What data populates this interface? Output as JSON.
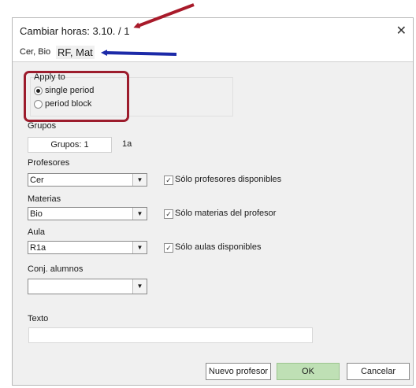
{
  "window": {
    "title": "Cambiar horas:  3.10. / 1",
    "close_glyph": "✕"
  },
  "tabs": [
    {
      "label": "Cer, Bio"
    },
    {
      "label": "RF, Mat"
    }
  ],
  "apply_to": {
    "legend": "Apply to",
    "options": [
      "single period",
      "period block"
    ],
    "selected": 0
  },
  "grupos": {
    "label": "Grupos",
    "button": "Grupos: 1",
    "value": "1a"
  },
  "profesores": {
    "label": "Profesores",
    "value": "Cer",
    "check_label": "Sólo profesores disponibles",
    "checked": true
  },
  "materias": {
    "label": "Materias",
    "value": "Bio",
    "check_label": "Sólo materias del profesor",
    "checked": true
  },
  "aula": {
    "label": "Aula",
    "value": "R1a",
    "check_label": "Sólo aulas disponibles",
    "checked": true
  },
  "conj": {
    "label": "Conj. alumnos",
    "value": ""
  },
  "texto": {
    "label": "Texto",
    "value": ""
  },
  "buttons": {
    "new_teacher": "Nuevo profesor",
    "ok": "OK",
    "cancel": "Cancelar"
  },
  "colors": {
    "highlight_border": "#9c1c2c",
    "red_arrow": "#a81a2a",
    "blue_arrow": "#1c2aa8",
    "ok_button": "#bfe0b5"
  }
}
